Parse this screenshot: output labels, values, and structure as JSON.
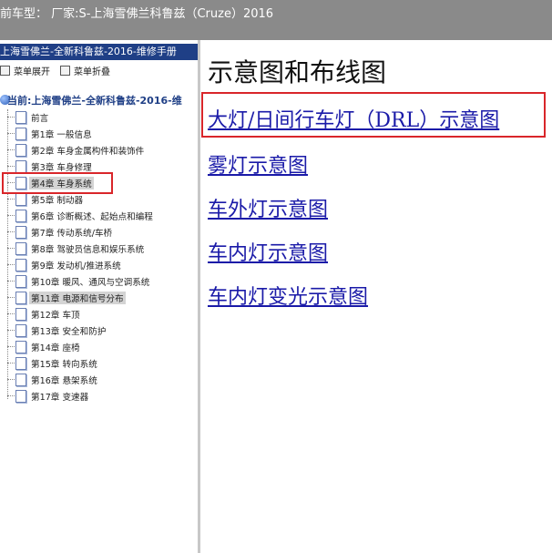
{
  "window": {
    "title": "前车型： 厂家:S-上海雪佛兰科鲁兹（Cruze）2016"
  },
  "left_panel": {
    "header": "上海雪佛兰-全新科鲁兹-2016-维修手册",
    "menu": {
      "expand_label": "菜单展开",
      "collapse_label": "菜单折叠"
    },
    "root_label": "当前:上海雪佛兰-全新科鲁兹-2016-维",
    "items": [
      {
        "label": "前言"
      },
      {
        "label": "第1章 一般信息"
      },
      {
        "label": "第2章 车身金属构件和装饰件"
      },
      {
        "label": "第3章 车身修理"
      },
      {
        "label": "第4章 车身系统"
      },
      {
        "label": "第5章 制动器"
      },
      {
        "label": "第6章 诊断概述、起始点和编程"
      },
      {
        "label": "第7章 传动系统/车桥"
      },
      {
        "label": "第8章 驾驶员信息和娱乐系统"
      },
      {
        "label": "第9章 发动机/推进系统"
      },
      {
        "label": "第10章 暖风、通风与空调系统"
      },
      {
        "label": "第11章 电源和信号分布"
      },
      {
        "label": "第12章 车顶"
      },
      {
        "label": "第13章 安全和防护"
      },
      {
        "label": "第14章 座椅"
      },
      {
        "label": "第15章 转向系统"
      },
      {
        "label": "第16章 悬架系统"
      },
      {
        "label": "第17章 变速器"
      }
    ]
  },
  "main": {
    "heading": "示意图和布线图",
    "links": [
      {
        "label": "大灯/日间行车灯（DRL）示意图"
      },
      {
        "label": "雾灯示意图"
      },
      {
        "label": "车外灯示意图"
      },
      {
        "label": "车内灯示意图"
      },
      {
        "label": "车内灯变光示意图"
      }
    ]
  },
  "colors": {
    "highlight_box": "#d9262a",
    "link": "#1a1aa8",
    "header_bg": "#1f3f86"
  }
}
